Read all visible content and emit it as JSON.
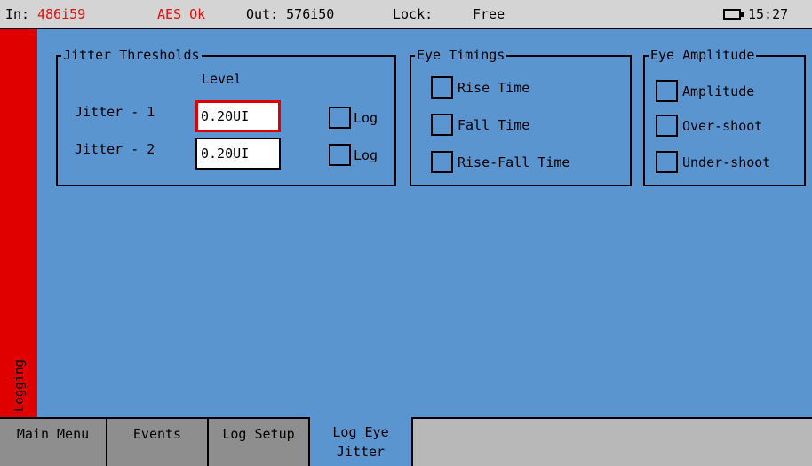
{
  "status": {
    "in_label": "In:",
    "in_value": "486i59",
    "aes": "AES Ok",
    "out": "Out: 576i50",
    "lock_label": "Lock:",
    "lock_value": "Free",
    "time": "15:27"
  },
  "sidebar": {
    "label": "Logging"
  },
  "jitter": {
    "title": "Jitter Thresholds",
    "level_header": "Level",
    "rows": [
      {
        "label": "Jitter - 1",
        "value": "0.20UI",
        "log_label": "Log"
      },
      {
        "label": "Jitter - 2",
        "value": "0.20UI",
        "log_label": "Log"
      }
    ]
  },
  "eye_timings": {
    "title": "Eye Timings",
    "options": [
      "Rise Time",
      "Fall Time",
      "Rise-Fall Time"
    ]
  },
  "eye_amplitude": {
    "title": "Eye Amplitude",
    "options": [
      "Amplitude",
      "Over-shoot",
      "Under-shoot"
    ]
  },
  "menu": {
    "tabs": [
      "Main Menu",
      "Events",
      "Log Setup",
      "Log Eye Jitter"
    ]
  }
}
